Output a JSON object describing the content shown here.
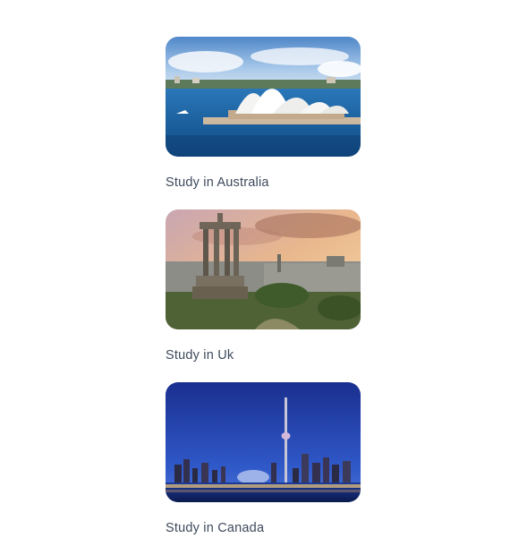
{
  "destinations": [
    {
      "label": "Study in Australia",
      "image": "sydney-opera-house-photo",
      "colors": {
        "sky": "#6f9fd6",
        "water": "#1b5fa0"
      }
    },
    {
      "label": "Study in Uk",
      "image": "edinburgh-calton-hill-photo",
      "colors": {
        "sky": "#e8b48a",
        "ground": "#4d5a35"
      }
    },
    {
      "label": "Study in Canada",
      "image": "toronto-skyline-night-photo",
      "colors": {
        "sky": "#1f3fa8",
        "water": "#0d1e55"
      }
    }
  ]
}
